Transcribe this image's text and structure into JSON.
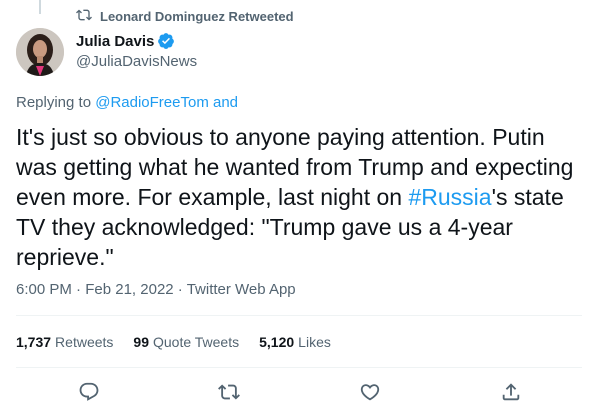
{
  "retweet_banner": {
    "text": "Leonard Dominguez Retweeted",
    "icon": "retweet-icon"
  },
  "author": {
    "name": "Julia Davis",
    "handle": "@JuliaDavisNews",
    "verified": true
  },
  "replying": {
    "prefix": "Replying to",
    "mention": "@RadioFreeTom and"
  },
  "tweet": {
    "text_before": "It's just so obvious to anyone paying attention. Putin was getting what he wanted from Trump and expecting even more. For example, last night on ",
    "hashtag": "#Russia",
    "text_after": "'s state TV they acknowledged: \"Trump gave us a 4-year reprieve.\""
  },
  "meta": {
    "time": "6:00 PM",
    "date": "Feb 21, 2022",
    "source": "Twitter Web App",
    "separator": "·"
  },
  "stats": {
    "retweets": {
      "count": "1,737",
      "label": "Retweets"
    },
    "quotes": {
      "count": "99",
      "label": "Quote Tweets"
    },
    "likes": {
      "count": "5,120",
      "label": "Likes"
    }
  },
  "actions": [
    "reply-icon",
    "retweet-icon",
    "like-icon",
    "share-icon"
  ],
  "colors": {
    "accent": "#1d9bf0",
    "secondary_text": "#536471",
    "primary_text": "#0f1419",
    "divider": "#eff3f4"
  }
}
